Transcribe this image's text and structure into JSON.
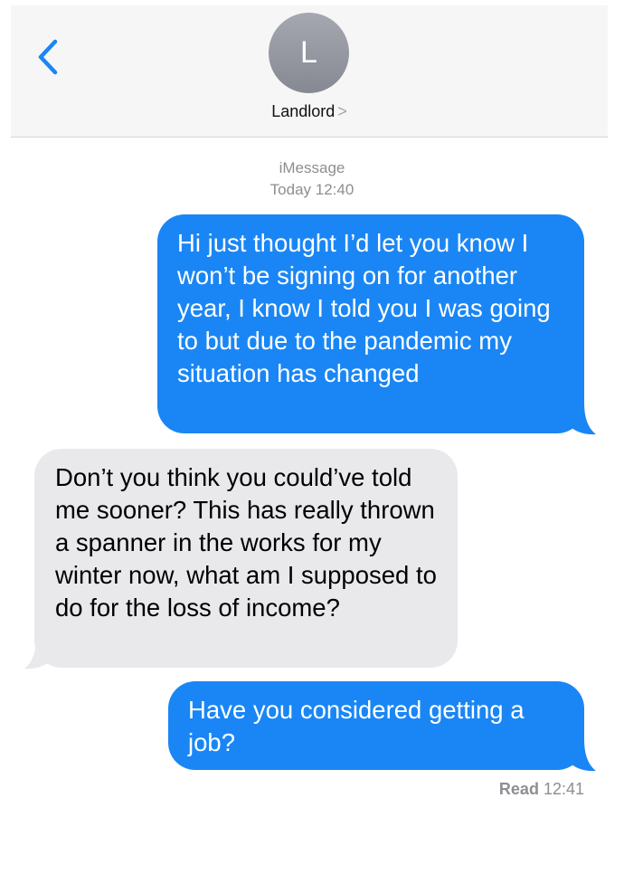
{
  "header": {
    "back_icon": "chevron-left-icon",
    "avatar_initial": "L",
    "contact_name": "Landlord",
    "contact_chevron": ">"
  },
  "thread": {
    "service": "iMessage",
    "timestamp": "Today 12:40"
  },
  "messages": [
    {
      "direction": "sent",
      "text": "Hi just thought I’d let you know I won’t be signing on for another year, I know I told you I was going to but due to the pandemic my situation has changed"
    },
    {
      "direction": "received",
      "text": "Don’t you think you could’ve told me sooner? This has really thrown a spanner in the works for my winter now, what am I supposed to do for the loss of income?"
    },
    {
      "direction": "sent",
      "text": "Have you considered getting a job?"
    }
  ],
  "receipt": {
    "status": "Read",
    "time": "12:41"
  },
  "colors": {
    "sent_bubble": "#1a86f5",
    "received_bubble": "#e9e9eb",
    "accent": "#1a86f5",
    "meta_text": "#8e8e93"
  }
}
